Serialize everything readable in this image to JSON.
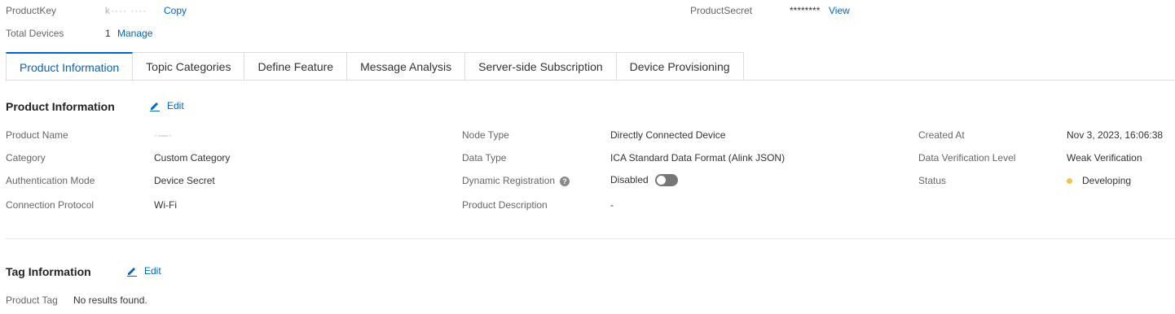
{
  "header": {
    "product_key_label": "ProductKey",
    "product_key_value": "k····  ····",
    "copy_label": "Copy",
    "product_secret_label": "ProductSecret",
    "product_secret_value": "********",
    "view_label": "View",
    "total_devices_label": "Total Devices",
    "total_devices_value": "1",
    "manage_label": "Manage"
  },
  "tabs": [
    {
      "label": "Product Information",
      "active": true
    },
    {
      "label": "Topic Categories"
    },
    {
      "label": "Define Feature"
    },
    {
      "label": "Message Analysis"
    },
    {
      "label": "Server-side Subscription"
    },
    {
      "label": "Device Provisioning"
    }
  ],
  "product_info": {
    "title": "Product Information",
    "edit_label": "Edit",
    "product_name_label": "Product Name",
    "product_name_value": "·—·",
    "category_label": "Category",
    "category_value": "Custom Category",
    "auth_mode_label": "Authentication Mode",
    "auth_mode_value": "Device Secret",
    "protocol_label": "Connection Protocol",
    "protocol_value": "Wi-Fi",
    "node_type_label": "Node Type",
    "node_type_value": "Directly Connected Device",
    "data_type_label": "Data Type",
    "data_type_value": "ICA Standard Data Format (Alink JSON)",
    "dynamic_reg_label": "Dynamic Registration",
    "dynamic_reg_value": "Disabled",
    "description_label": "Product Description",
    "description_value": "-",
    "created_at_label": "Created At",
    "created_at_value": "Nov 3, 2023, 16:06:38",
    "verification_label": "Data Verification Level",
    "verification_value": "Weak Verification",
    "status_label": "Status",
    "status_value": "Developing"
  },
  "tag_info": {
    "title": "Tag Information",
    "edit_label": "Edit",
    "product_tag_label": "Product Tag",
    "product_tag_value": "No results found."
  },
  "colors": {
    "accent": "#0064c8",
    "status_developing": "#f5c343"
  }
}
